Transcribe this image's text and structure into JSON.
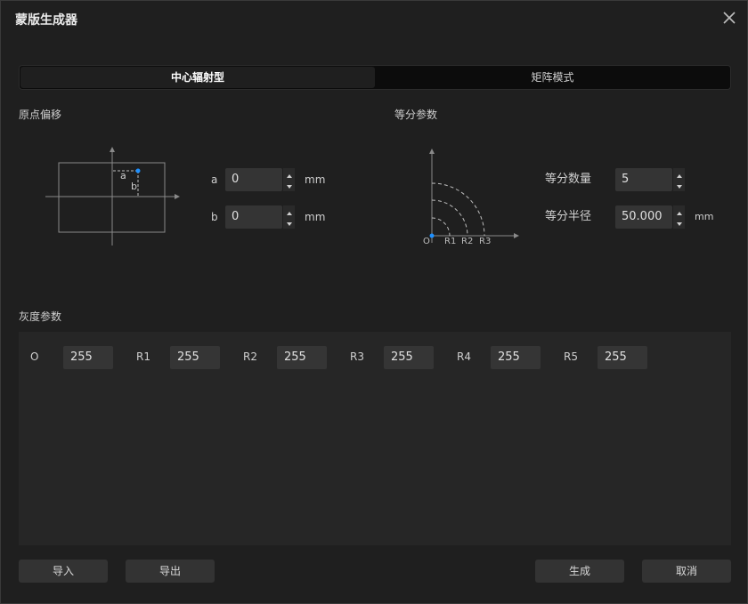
{
  "window": {
    "title": "蒙版生成器",
    "close_icon": "close-icon"
  },
  "mode_tabs": [
    {
      "label": "中心辐射型",
      "active": true
    },
    {
      "label": "矩阵模式",
      "active": false
    }
  ],
  "origin_offset": {
    "section_label": "原点偏移",
    "diagram_labels": {
      "a": "a",
      "b": "b"
    },
    "fields": [
      {
        "label": "a",
        "value": "0",
        "unit": "mm"
      },
      {
        "label": "b",
        "value": "0",
        "unit": "mm"
      }
    ]
  },
  "division_params": {
    "section_label": "等分参数",
    "diagram_labels": {
      "origin": "O",
      "r1": "R1",
      "r2": "R2",
      "r3": "R3"
    },
    "count": {
      "label": "等分数量",
      "value": "5"
    },
    "radius": {
      "label": "等分半径",
      "value": "50.000",
      "unit": "mm"
    }
  },
  "gray_params": {
    "section_label": "灰度参数",
    "items": [
      {
        "label": "O",
        "value": "255"
      },
      {
        "label": "R1",
        "value": "255"
      },
      {
        "label": "R2",
        "value": "255"
      },
      {
        "label": "R3",
        "value": "255"
      },
      {
        "label": "R4",
        "value": "255"
      },
      {
        "label": "R5",
        "value": "255"
      }
    ]
  },
  "footer": {
    "import_label": "导入",
    "export_label": "导出",
    "generate_label": "生成",
    "cancel_label": "取消"
  },
  "colors": {
    "accent_dot": "#1e90ff",
    "background": "#1f1f1f",
    "input_bg": "#343434"
  }
}
